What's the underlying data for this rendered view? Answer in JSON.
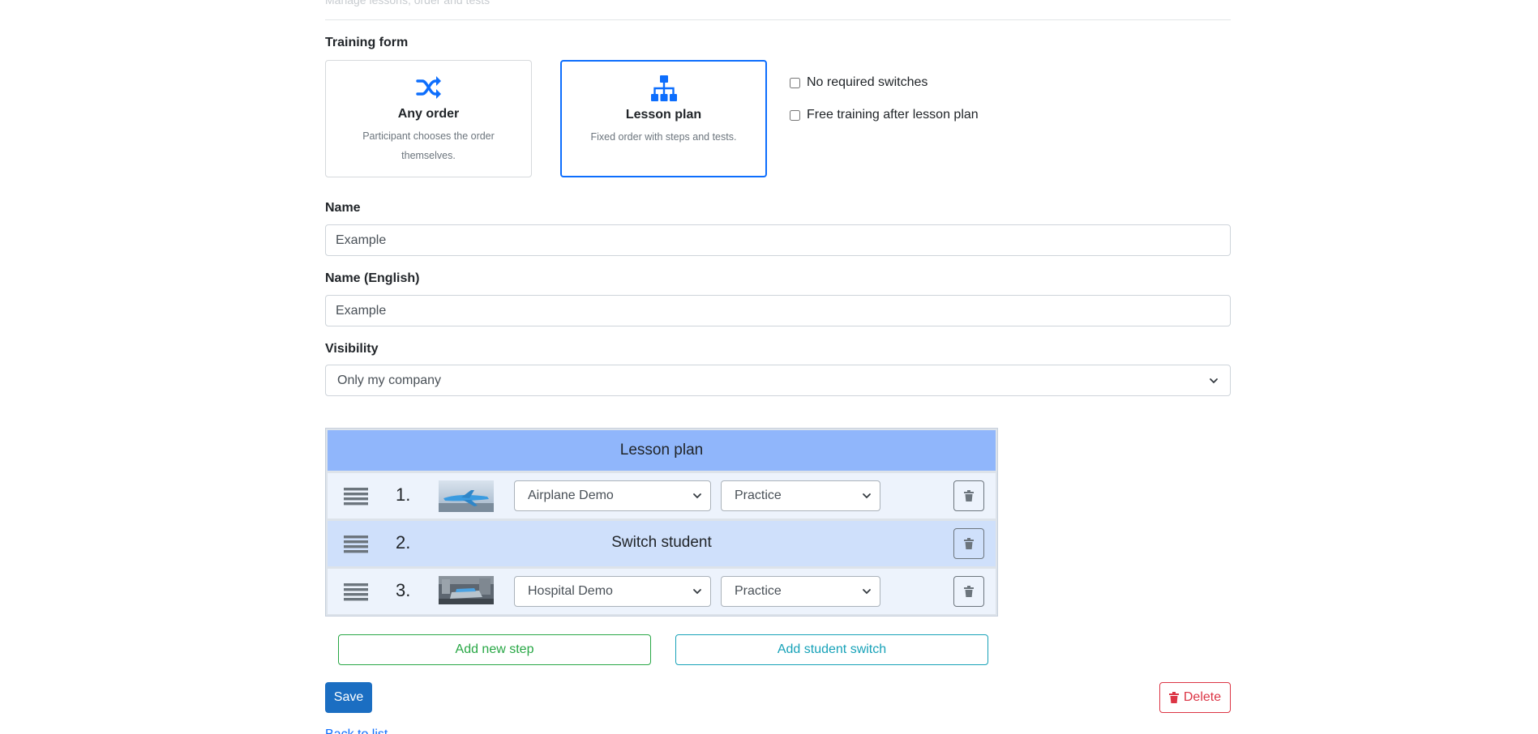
{
  "header": {
    "faded_text": "Manage lessons, order and tests"
  },
  "training_form": {
    "label": "Training form",
    "options": [
      {
        "title": "Any order",
        "description": "Participant chooses the order themselves.",
        "icon": "shuffle-icon",
        "selected": false
      },
      {
        "title": "Lesson plan",
        "description": "Fixed order with steps and tests.",
        "icon": "sitemap-icon",
        "selected": true
      }
    ],
    "checkboxes": [
      {
        "label": "No required switches",
        "checked": false
      },
      {
        "label": "Free training after lesson plan",
        "checked": false
      }
    ]
  },
  "name": {
    "label": "Name",
    "value": "Example"
  },
  "name_en": {
    "label": "Name (English)",
    "value": "Example"
  },
  "visibility": {
    "label": "Visibility",
    "selected": "Only my company"
  },
  "lesson_plan": {
    "title": "Lesson plan",
    "rows": [
      {
        "number": "1.",
        "type": "step",
        "scenario": "Airplane Demo",
        "mode": "Practice",
        "thumbnail": "airplane-thumbnail"
      },
      {
        "number": "2.",
        "type": "switch",
        "label": "Switch student"
      },
      {
        "number": "3.",
        "type": "step",
        "scenario": "Hospital Demo",
        "mode": "Practice",
        "thumbnail": "hospital-thumbnail"
      }
    ]
  },
  "actions": {
    "add_step": "Add new step",
    "add_switch": "Add student switch",
    "save": "Save",
    "delete": "Delete",
    "back": "Back to list"
  },
  "colors": {
    "primary": "#0d6efd",
    "save": "#1b6ec2",
    "plan_header": "#90b6fb",
    "switch_row": "#cfe0fb",
    "step_row": "#edf3fc",
    "success": "#28a745",
    "info": "#17a2b8",
    "danger": "#dc3545"
  }
}
